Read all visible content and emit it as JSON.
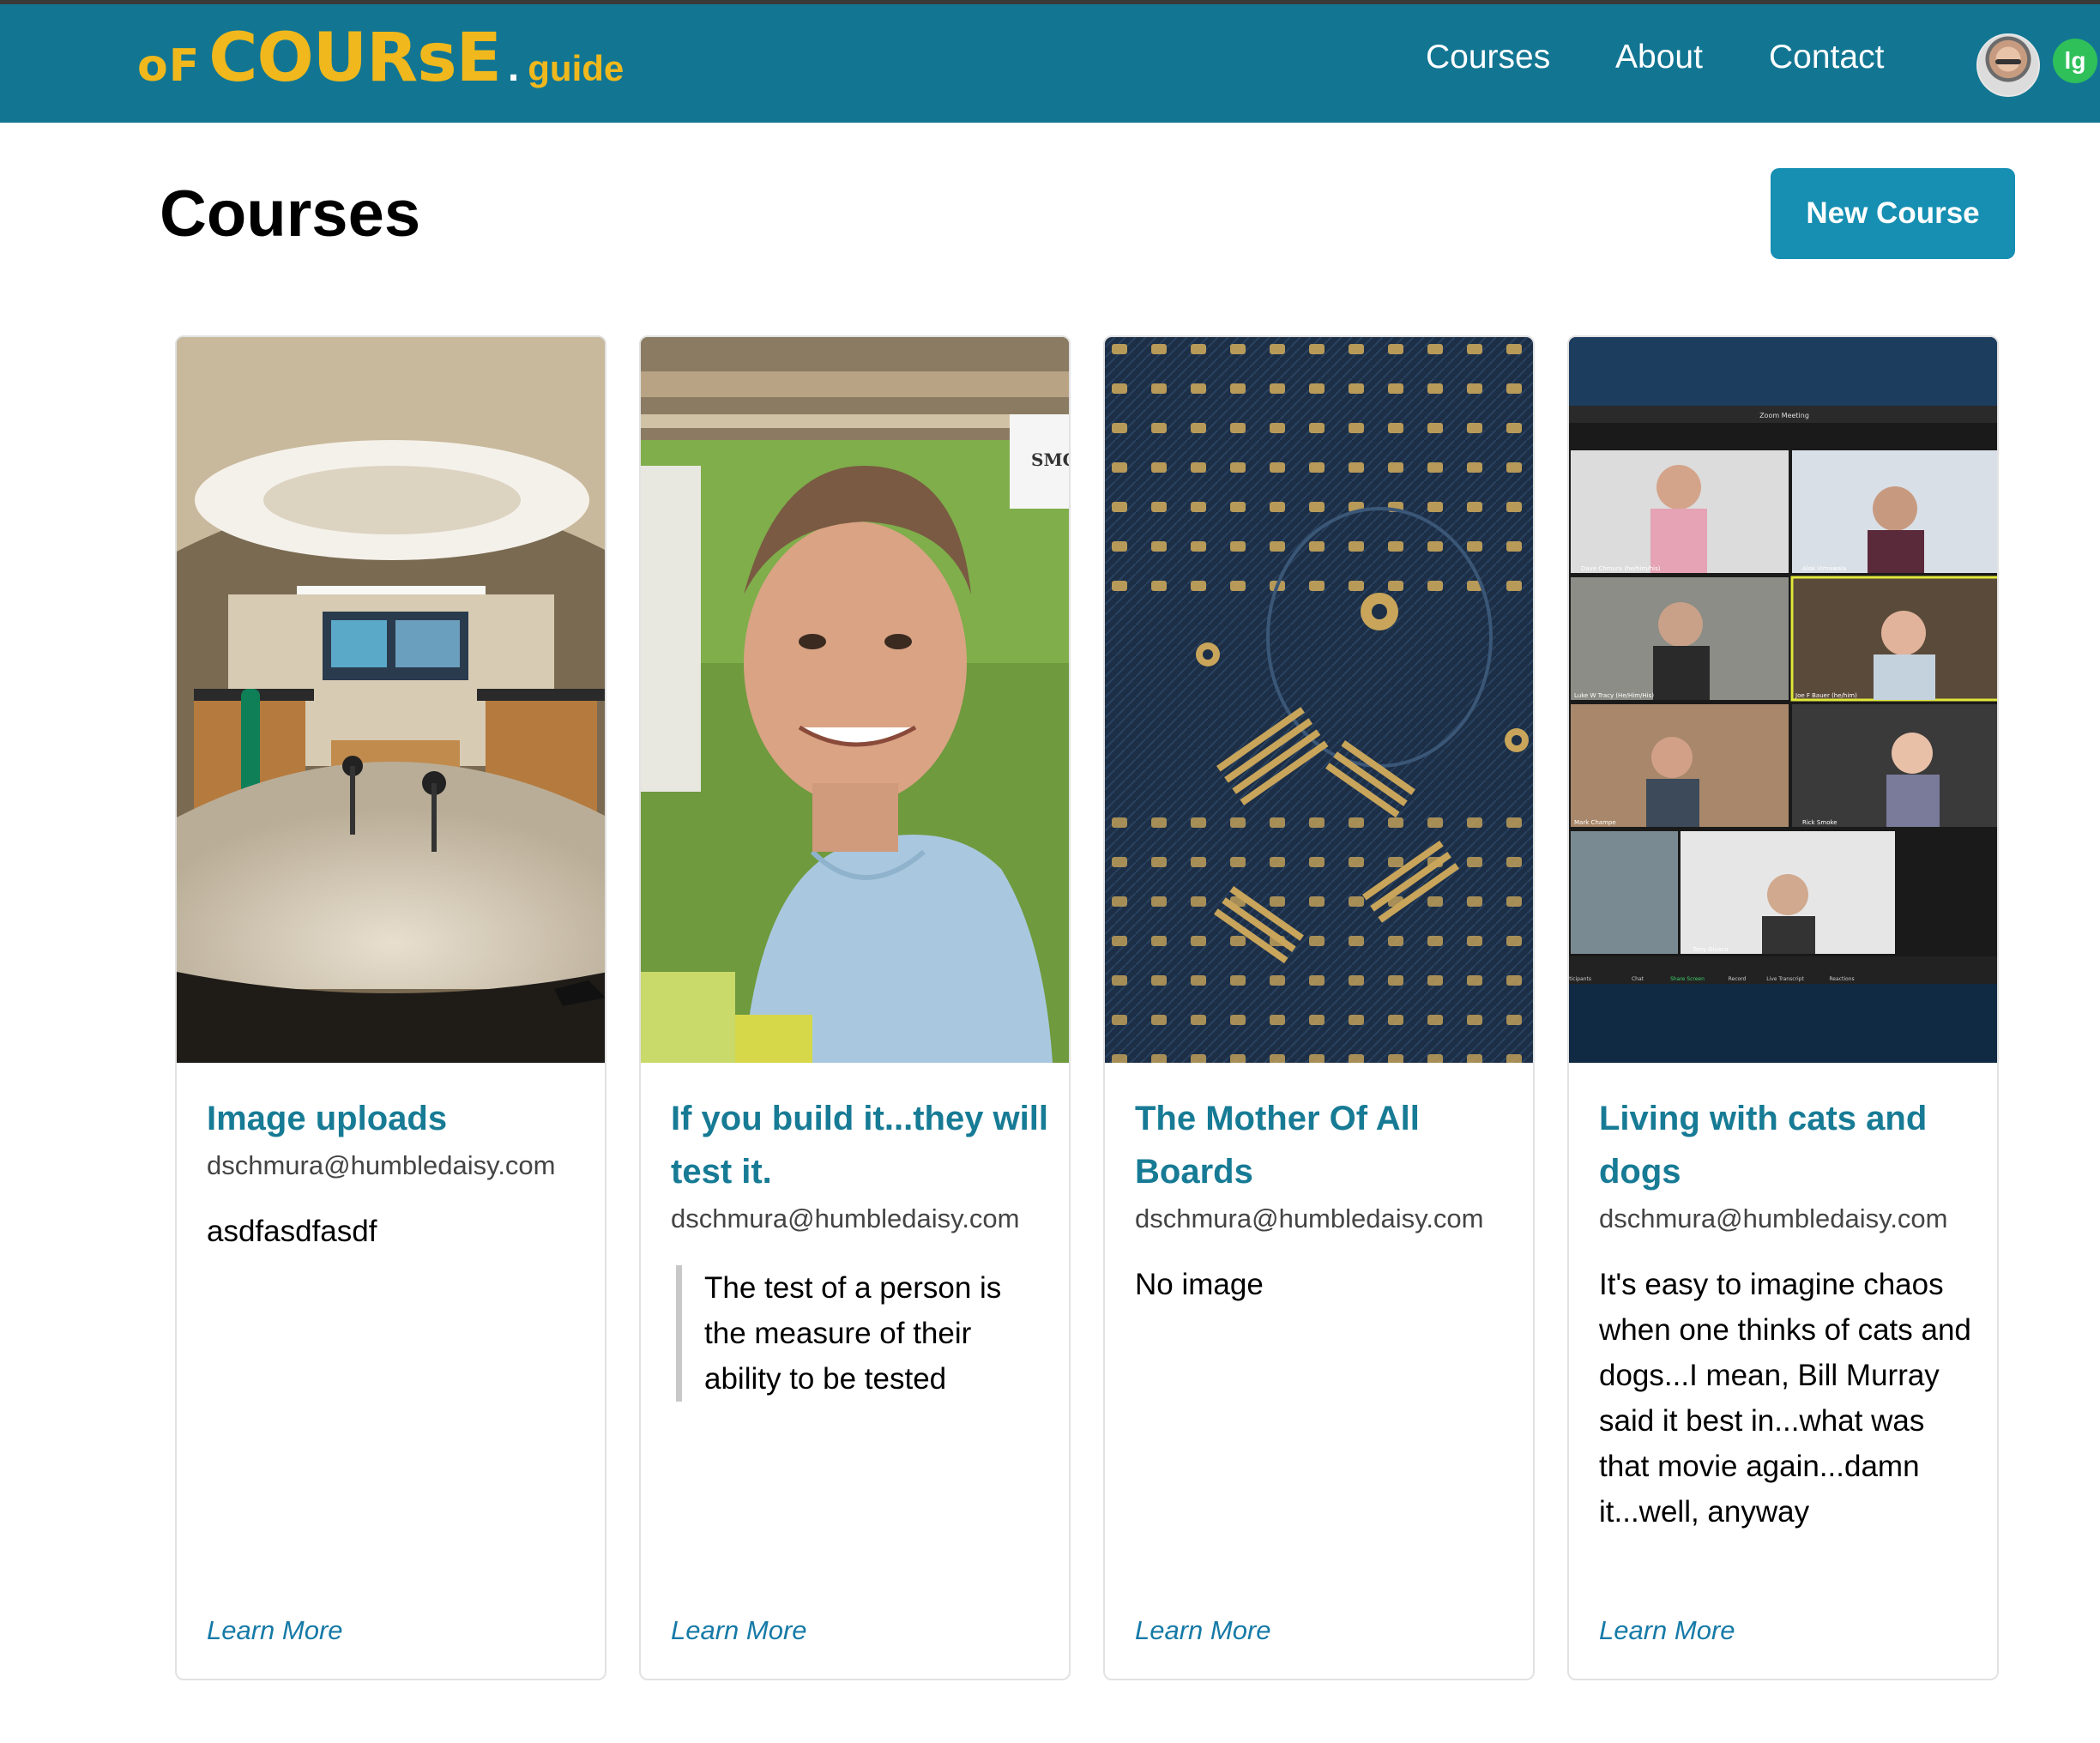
{
  "brand": {
    "of": "oF",
    "course": "COURsE",
    "dot": ".",
    "guide": "guide"
  },
  "nav": {
    "links": [
      "Courses",
      "About",
      "Contact"
    ],
    "user_initials": "lg"
  },
  "page": {
    "title": "Courses",
    "new_course_label": "New Course"
  },
  "zoom_tile": {
    "title": "Zoom Meeting",
    "participants": [
      "Dave Chmura (he/him/his)",
      "Alok Vimawala",
      "Luke W Tracy (He/Him/His)",
      "Joe F Bauer (he/him)",
      "Mark Champe",
      "Rick Smoke",
      "Tony Giusca"
    ],
    "toolbar": [
      "articipants",
      "Chat",
      "Share Screen",
      "Record",
      "Live Transcript",
      "Reactions"
    ]
  },
  "courses": [
    {
      "title": "Image uploads",
      "email": "dschmura@humbledaisy.com",
      "text": "asdfasdfasdf",
      "link": "Learn More",
      "image": "lab-panorama"
    },
    {
      "title": "If you build it...they will test it.",
      "email": "dschmura@humbledaisy.com",
      "quote": "The test of a person is the measure of their ability to be tested",
      "link": "Learn More",
      "image": "portrait-man",
      "sign_text": "SMC"
    },
    {
      "title": "The Mother Of All Boards",
      "email": "dschmura@humbledaisy.com",
      "text": "No image",
      "link": "Learn More",
      "image": "circuit-board"
    },
    {
      "title": "Living with cats and dogs",
      "email": "dschmura@humbledaisy.com",
      "text": "It's easy to imagine chaos when one thinks of cats and dogs...I mean, Bill Murray said it best in...what was that movie again...damn it...well, anyway",
      "link": "Learn More",
      "image": "zoom-meeting"
    }
  ],
  "colors": {
    "navbar": "#127693",
    "brand_yellow": "#f0b81c",
    "button": "#168fb2",
    "card_title": "#177b95",
    "link": "#157aa7",
    "badge": "#2fc05a"
  }
}
